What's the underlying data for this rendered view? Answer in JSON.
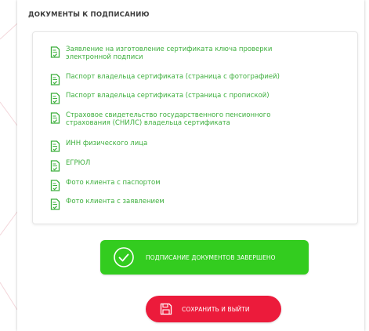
{
  "colors": {
    "accent_green": "#33cc1f",
    "link_green": "#3daf3d",
    "danger_red": "#ec1b3b"
  },
  "section_title": "ДОКУМЕНТЫ К ПОДПИСАНИЮ",
  "documents": [
    {
      "label": "Заявление на изготовление сертификата ключа проверки электронной подписи",
      "icon": "document-check-icon"
    },
    {
      "label": "Паспорт владельца сертификата (страница с фотографией)",
      "icon": "document-check-icon"
    },
    {
      "label": "Паспорт владельца сертификата (страница с пропиской)",
      "icon": "document-check-icon"
    },
    {
      "label": "Страховое свидетельство государственного пенсионного страхования (СНИЛС) владельца сертификата",
      "icon": "document-check-icon"
    },
    {
      "label": "ИНН физического лица",
      "icon": "document-check-icon"
    },
    {
      "label": "ЕГРЮЛ",
      "icon": "document-check-icon"
    },
    {
      "label": "Фото клиента с паспортом",
      "icon": "document-check-icon"
    },
    {
      "label": "Фото клиента с заявлением",
      "icon": "document-check-icon"
    }
  ],
  "buttons": {
    "done_label": "ПОДПИСАНИЕ ДОКУМЕНТОВ ЗАВЕРШЕНО",
    "done_icon": "check-circle-icon",
    "save_label": "СОХРАНИТЬ И ВЫЙТИ",
    "save_icon": "save-icon"
  }
}
